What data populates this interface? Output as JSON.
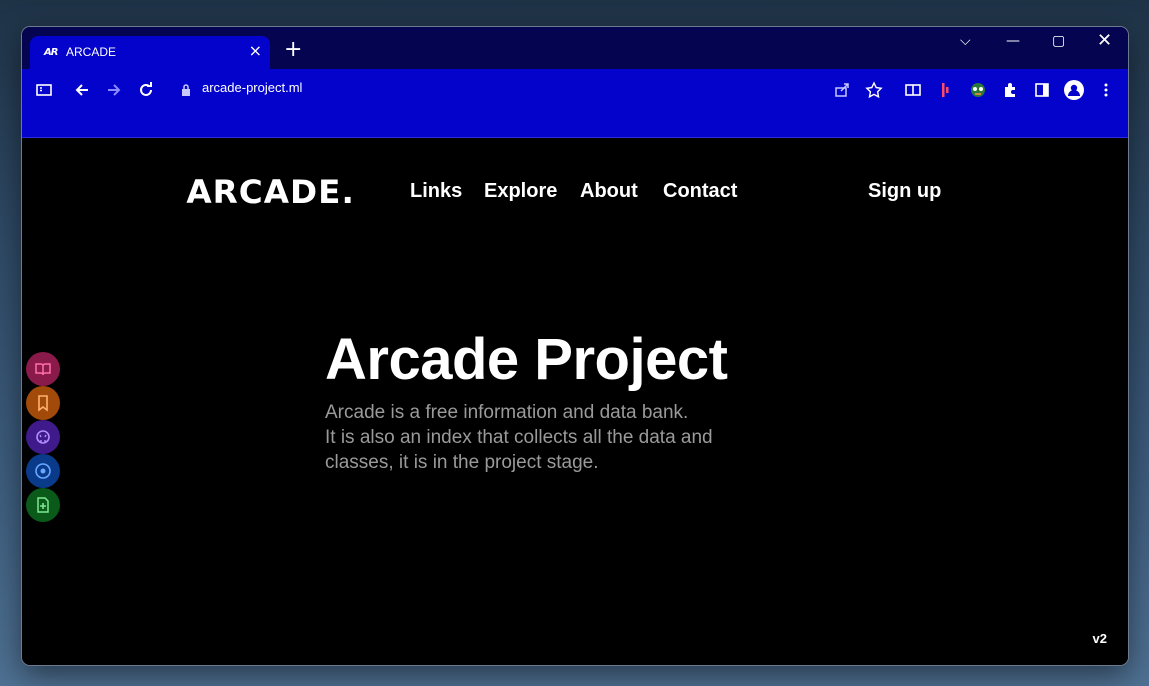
{
  "browser": {
    "tab_title": "ARCADE",
    "tab_favicon": "AR",
    "url": "arcade-project.ml"
  },
  "site": {
    "logo": "ARCADE.",
    "nav": [
      "Links",
      "Explore",
      "About",
      "Contact"
    ],
    "signup": "Sign up",
    "hero_title": "Arcade Project",
    "hero_lines": [
      "Arcade is a free information and data bank.",
      "It is also an index that collects all the data and",
      "classes, it is in the project stage."
    ],
    "version": "v2"
  },
  "side_buttons": [
    {
      "icon": "book-icon",
      "color": "#8a1a4a",
      "accent": "#ff6fa8"
    },
    {
      "icon": "bookmark-icon",
      "color": "#a24a0a",
      "accent": "#ffb070"
    },
    {
      "icon": "github-icon",
      "color": "#3e1a8a",
      "accent": "#b28cff"
    },
    {
      "icon": "target-icon",
      "color": "#0a3a8a",
      "accent": "#6aa8ff"
    },
    {
      "icon": "file-plus-icon",
      "color": "#0a5a1a",
      "accent": "#7de890"
    }
  ],
  "colors": {
    "toolbar": "#0303cc",
    "tabstrip": "#040450",
    "page_bg": "#000000",
    "desc_text": "#9a9a9a"
  }
}
